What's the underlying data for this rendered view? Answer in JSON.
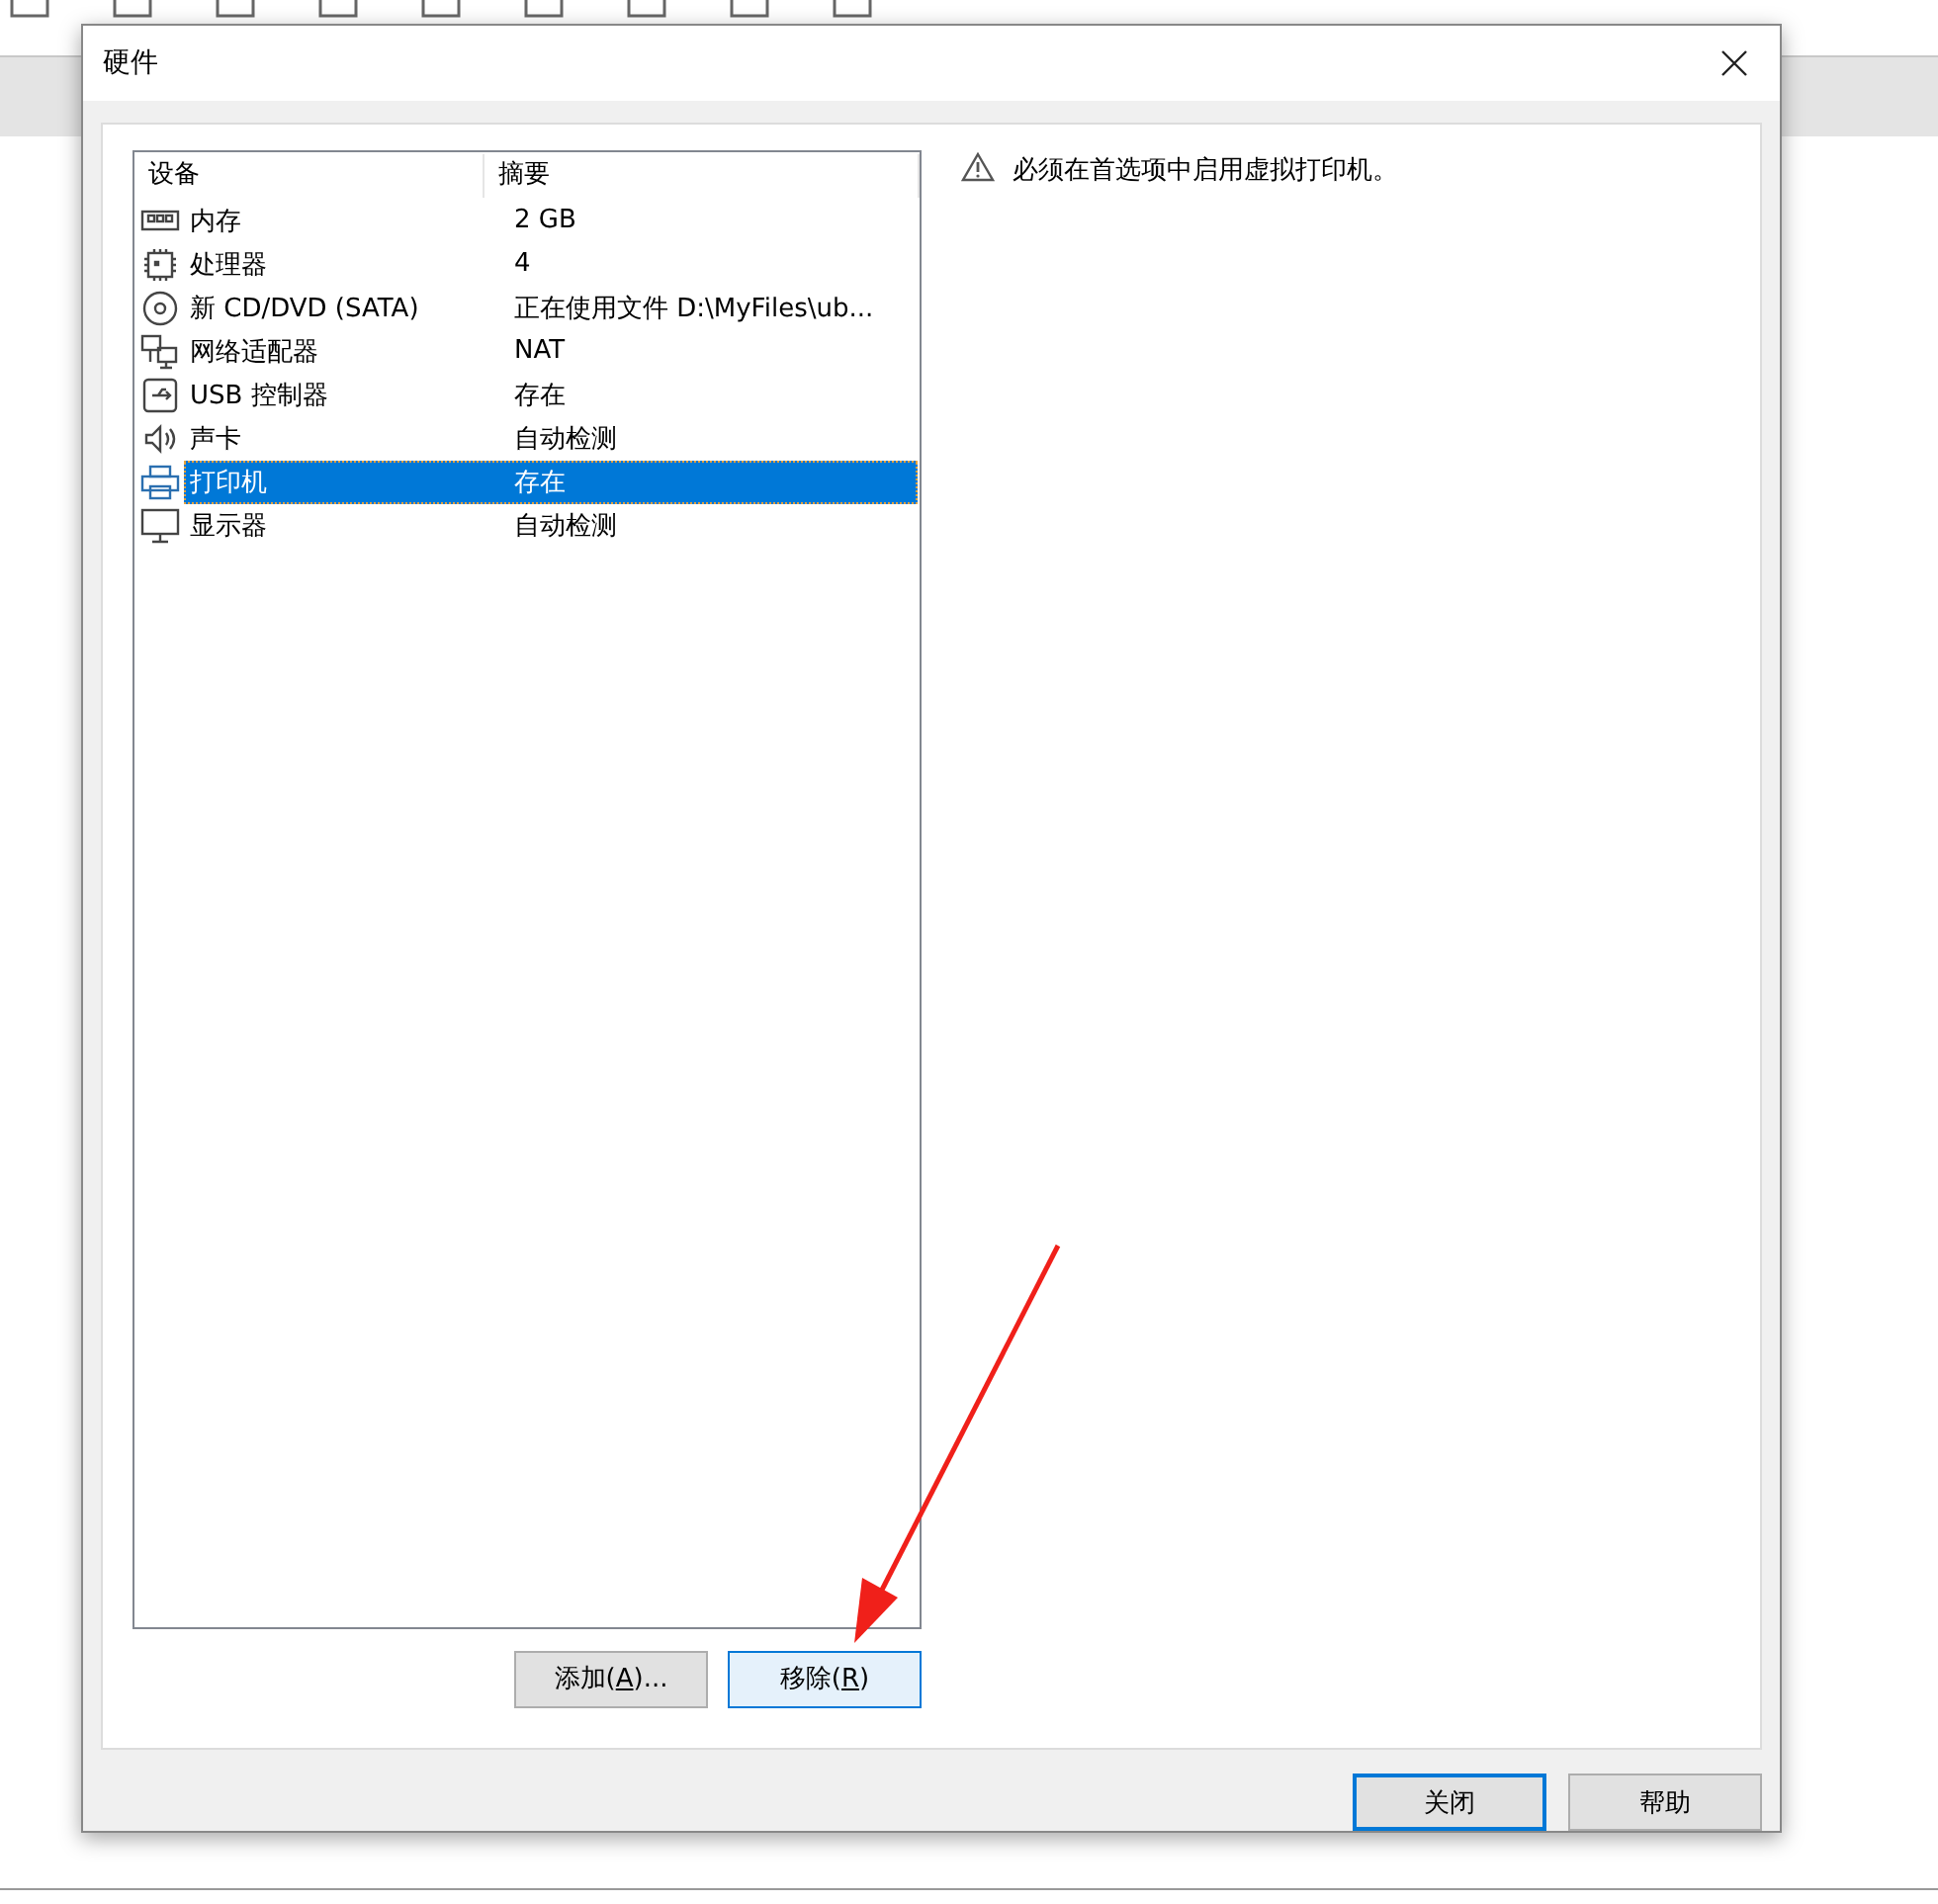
{
  "window": {
    "title": "硬件"
  },
  "table": {
    "columns": [
      "设备",
      "摘要"
    ],
    "rows": [
      {
        "kind": "memory",
        "device": "内存",
        "summary": "2 GB",
        "selected": false
      },
      {
        "kind": "cpu",
        "device": "处理器",
        "summary": "4",
        "selected": false
      },
      {
        "kind": "disc",
        "device": "新 CD/DVD (SATA)",
        "summary": "正在使用文件 D:\\MyFiles\\ub...",
        "selected": false
      },
      {
        "kind": "network",
        "device": "网络适配器",
        "summary": "NAT",
        "selected": false
      },
      {
        "kind": "usb",
        "device": "USB 控制器",
        "summary": "存在",
        "selected": false
      },
      {
        "kind": "sound",
        "device": "声卡",
        "summary": "自动检测",
        "selected": false
      },
      {
        "kind": "printer",
        "device": "打印机",
        "summary": "存在",
        "selected": true
      },
      {
        "kind": "display",
        "device": "显示器",
        "summary": "自动检测",
        "selected": false
      }
    ]
  },
  "notice": "必须在首选项中启用虚拟打印机。",
  "list_buttons": [
    {
      "before": "添加(",
      "key": "A",
      "after": ")...",
      "hovered": false,
      "default": false
    },
    {
      "before": "移除(",
      "key": "R",
      "after": ")",
      "hovered": true,
      "default": false
    }
  ],
  "footer_buttons": [
    {
      "label": "关闭",
      "hovered": false,
      "default": true
    },
    {
      "label": "帮助",
      "hovered": false,
      "default": false
    }
  ]
}
